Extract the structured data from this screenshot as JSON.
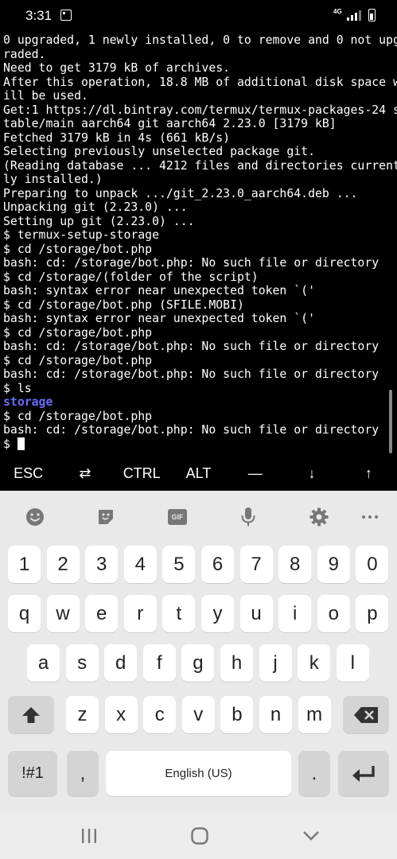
{
  "status_bar": {
    "time": "3:31",
    "network": "4G",
    "icons": [
      "screenshot-icon",
      "signal-icon",
      "battery-icon"
    ]
  },
  "terminal": {
    "lines": [
      "0 upgraded, 1 newly installed, 0 to remove and 0 not upg",
      "raded.",
      "Need to get 3179 kB of archives.",
      "After this operation, 18.8 MB of additional disk space w",
      "ill be used.",
      "Get:1 https://dl.bintray.com/termux/termux-packages-24 s",
      "table/main aarch64 git aarch64 2.23.0 [3179 kB]",
      "Fetched 3179 kB in 4s (661 kB/s)",
      "Selecting previously unselected package git.",
      "(Reading database ... 4212 files and directories current",
      "ly installed.)",
      "Preparing to unpack .../git_2.23.0_aarch64.deb ...",
      "Unpacking git (2.23.0) ...",
      "Setting up git (2.23.0) ...",
      "$ termux-setup-storage",
      "$ cd /storage/bot.php",
      "bash: cd: /storage/bot.php: No such file or directory",
      "$ cd /storage/(folder of the script)",
      "bash: syntax error near unexpected token `('",
      "$ cd /storage/bot.php (SFILE.MOBI)",
      "bash: syntax error near unexpected token `('",
      "$ cd /storage/bot.php",
      "bash: cd: /storage/bot.php: No such file or directory",
      "$ cd /storage/bot.php",
      "bash: cd: /storage/bot.php: No such file or directory",
      "$ ls",
      "storage",
      "$ cd /storage/bot.php",
      "bash: cd: /storage/bot.php: No such file or directory"
    ],
    "prompt": "$ ",
    "directory_color": "#6c6cff"
  },
  "extra_keys": [
    {
      "label": "ESC",
      "name": "esc-key"
    },
    {
      "label": "⇄",
      "name": "tab-key"
    },
    {
      "label": "CTRL",
      "name": "ctrl-key"
    },
    {
      "label": "ALT",
      "name": "alt-key"
    },
    {
      "label": "—",
      "name": "dash-key"
    },
    {
      "label": "↓",
      "name": "down-arrow-key"
    },
    {
      "label": "↑",
      "name": "up-arrow-key"
    }
  ],
  "keyboard": {
    "toolbar_icons": [
      "emoji-icon",
      "sticker-icon",
      "gif-icon",
      "microphone-icon",
      "settings-icon",
      "more-icon"
    ],
    "gif_label": "GIF",
    "number_row": [
      "1",
      "2",
      "3",
      "4",
      "5",
      "6",
      "7",
      "8",
      "9",
      "0"
    ],
    "row1": [
      "q",
      "w",
      "e",
      "r",
      "t",
      "y",
      "u",
      "i",
      "o",
      "p"
    ],
    "row2": [
      "a",
      "s",
      "d",
      "f",
      "g",
      "h",
      "j",
      "k",
      "l"
    ],
    "row3": [
      "z",
      "x",
      "c",
      "v",
      "b",
      "n",
      "m"
    ],
    "symbols_label": "!#1",
    "comma_label": ",",
    "space_label": "English (US)",
    "period_label": ".",
    "key_color": "#ffffff",
    "function_key_color": "#d4d4d4"
  },
  "nav_bar": {
    "icons": [
      "recent-apps-icon",
      "home-icon",
      "back-icon"
    ]
  }
}
